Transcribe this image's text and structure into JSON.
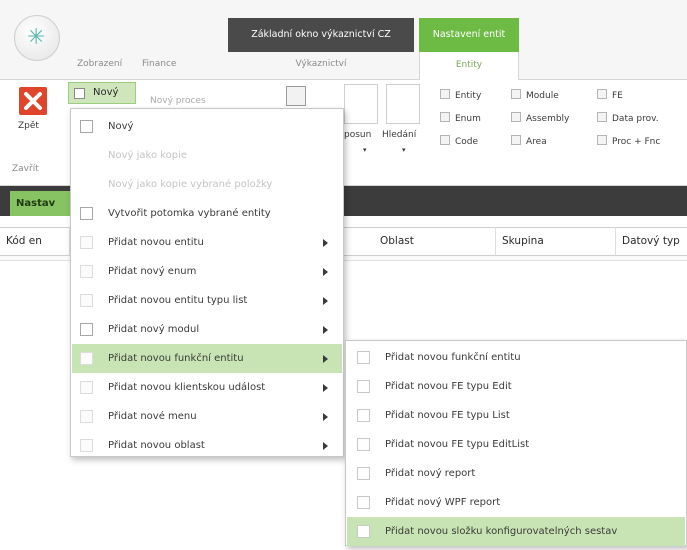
{
  "ribbon": {
    "tabs": {
      "zobrazeni": "Zobrazení",
      "finance": "Finance",
      "vykaznictvi": "Výkaznictví",
      "entity": "Entity"
    },
    "context_group": "Základní okno výkaznictví CZ",
    "settings_group": "Nastavení entit",
    "close_button": "Zpět",
    "close_group": "Zavřít",
    "new_button": "Nový",
    "obscured_labels": {
      "tool_label": "Nový proces",
      "posun": "posun",
      "hledani": "Hledání"
    },
    "checkboxes": [
      "Entity",
      "Module",
      "FE",
      "Enum",
      "Assembly",
      "Data prov.",
      "Code",
      "Area",
      "Proc + Fnc"
    ]
  },
  "dark_bar": {
    "tab": "Nastav"
  },
  "grid": {
    "columns": [
      "Kód en",
      "Oblast",
      "Skupina",
      "Datový typ"
    ]
  },
  "menu": {
    "items": [
      {
        "label": "Nový",
        "enabled": true,
        "submenu": false
      },
      {
        "label": "Nový jako kopie",
        "enabled": false,
        "submenu": false
      },
      {
        "label": "Nový jako kopie vybrané položky",
        "enabled": false,
        "submenu": false
      },
      {
        "label": "Vytvořit potomka vybrané entity",
        "enabled": true,
        "submenu": false
      },
      {
        "label": "Přidat novou entitu",
        "enabled": true,
        "submenu": true
      },
      {
        "label": "Přidat nový enum",
        "enabled": true,
        "submenu": true
      },
      {
        "label": "Přidat novou entitu typu list",
        "enabled": true,
        "submenu": true
      },
      {
        "label": "Přidat nový modul",
        "enabled": true,
        "submenu": true
      },
      {
        "label": "Přidat novou funkční entitu",
        "enabled": true,
        "submenu": true,
        "highlighted": true
      },
      {
        "label": "Přidat novou klientskou událost",
        "enabled": true,
        "submenu": true
      },
      {
        "label": "Přidat nové menu",
        "enabled": true,
        "submenu": true
      },
      {
        "label": "Přidat novou oblast",
        "enabled": true,
        "submenu": true
      }
    ]
  },
  "submenu": {
    "items": [
      {
        "label": "Přidat novou funkční entitu"
      },
      {
        "label": "Přidat novou FE typu Edit"
      },
      {
        "label": "Přidat novou FE typu List"
      },
      {
        "label": "Přidat novou FE typu EditList"
      },
      {
        "label": "Přidat nový report"
      },
      {
        "label": "Přidat nový WPF report"
      },
      {
        "label": "Přidat novou složku konfigurovatelných sestav",
        "highlighted": true
      }
    ]
  },
  "colors": {
    "accent_green": "#6dbb45",
    "highlight_green": "#c9e4b4",
    "dark_bar": "#3c3c3c",
    "close_red": "#e0452c"
  }
}
